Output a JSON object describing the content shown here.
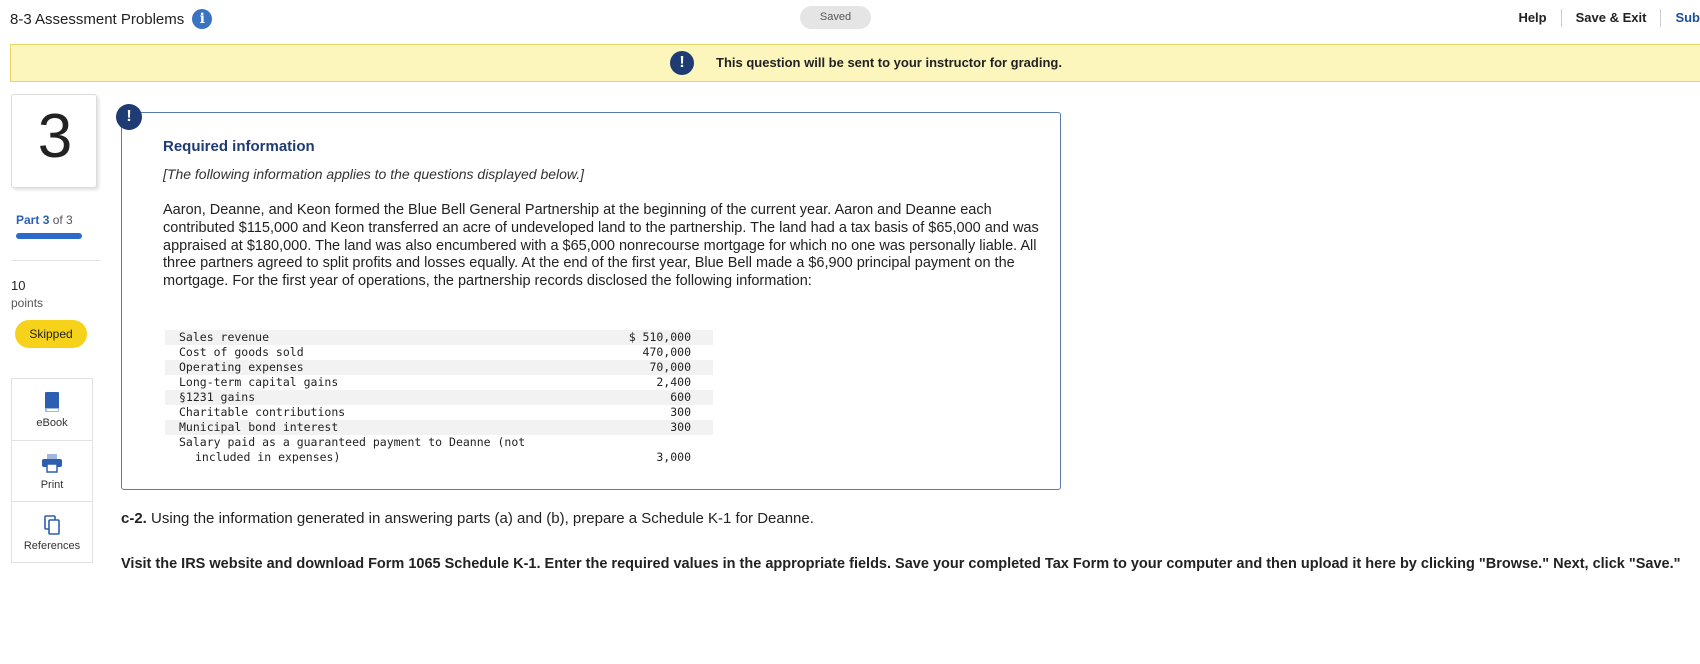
{
  "header": {
    "title": "8-3 Assessment Problems",
    "saved_label": "Saved",
    "help_label": "Help",
    "save_exit_label": "Save & Exit",
    "submit_label": "Sub"
  },
  "banner": {
    "text": "This question will be sent to your instructor for grading."
  },
  "sidebar": {
    "question_number": "3",
    "part_label": "Part",
    "part_current": "3",
    "part_of": "of 3",
    "points_value": "10",
    "points_label": "points",
    "status_badge": "Skipped",
    "tools": [
      {
        "label": "eBook",
        "icon": "book-icon"
      },
      {
        "label": "Print",
        "icon": "printer-icon"
      },
      {
        "label": "References",
        "icon": "copy-icon"
      }
    ]
  },
  "required_info": {
    "title": "Required information",
    "subtitle": "[The following information applies to the questions displayed below.]",
    "paragraph": "Aaron, Deanne, and Keon formed the Blue Bell General Partnership at the beginning of the current year. Aaron and Deanne each contributed $115,000 and Keon transferred an acre of undeveloped land to the partnership. The land had a tax basis of $65,000 and was appraised at $180,000. The land was also encumbered with a $65,000 nonrecourse mortgage for which no one was personally liable. All three partners agreed to split profits and losses equally. At the end of the first year, Blue Bell made a $6,900 principal payment on the mortgage. For the first year of operations, the partnership records disclosed the following information:",
    "table": [
      {
        "label": "Sales revenue",
        "value": "$ 510,000"
      },
      {
        "label": "Cost of goods sold",
        "value": "470,000"
      },
      {
        "label": "Operating expenses",
        "value": "70,000"
      },
      {
        "label": "Long-term capital gains",
        "value": "2,400"
      },
      {
        "label": "§1231 gains",
        "value": "600"
      },
      {
        "label": "Charitable contributions",
        "value": "300"
      },
      {
        "label": "Municipal bond interest",
        "value": "300"
      },
      {
        "label": "Salary paid as a guaranteed payment to Deanne (not",
        "value": ""
      },
      {
        "label": "included in expenses)",
        "value": "3,000"
      }
    ]
  },
  "question": {
    "part_id": "c-2.",
    "text": "Using the information generated in answering parts (a) and (b), prepare a Schedule K-1 for Deanne.",
    "instructions": "Visit the IRS website and download Form 1065 Schedule K-1. Enter the required values in the appropriate fields. Save your completed Tax Form to your computer and then upload it here by clicking \"Browse.\" Next, click \"Save.\""
  }
}
